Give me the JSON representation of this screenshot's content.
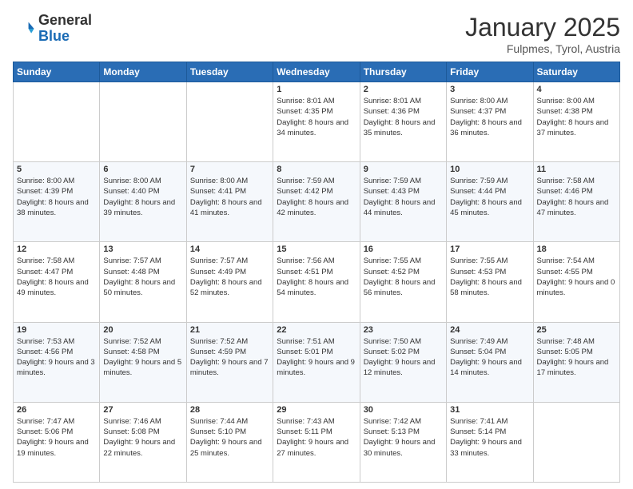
{
  "logo": {
    "general": "General",
    "blue": "Blue"
  },
  "header": {
    "month": "January 2025",
    "location": "Fulpmes, Tyrol, Austria"
  },
  "weekdays": [
    "Sunday",
    "Monday",
    "Tuesday",
    "Wednesday",
    "Thursday",
    "Friday",
    "Saturday"
  ],
  "weeks": [
    [
      {
        "day": null
      },
      {
        "day": null
      },
      {
        "day": null
      },
      {
        "day": 1,
        "sunrise": "8:01 AM",
        "sunset": "4:35 PM",
        "daylight": "8 hours and 34 minutes."
      },
      {
        "day": 2,
        "sunrise": "8:01 AM",
        "sunset": "4:36 PM",
        "daylight": "8 hours and 35 minutes."
      },
      {
        "day": 3,
        "sunrise": "8:00 AM",
        "sunset": "4:37 PM",
        "daylight": "8 hours and 36 minutes."
      },
      {
        "day": 4,
        "sunrise": "8:00 AM",
        "sunset": "4:38 PM",
        "daylight": "8 hours and 37 minutes."
      }
    ],
    [
      {
        "day": 5,
        "sunrise": "8:00 AM",
        "sunset": "4:39 PM",
        "daylight": "8 hours and 38 minutes."
      },
      {
        "day": 6,
        "sunrise": "8:00 AM",
        "sunset": "4:40 PM",
        "daylight": "8 hours and 39 minutes."
      },
      {
        "day": 7,
        "sunrise": "8:00 AM",
        "sunset": "4:41 PM",
        "daylight": "8 hours and 41 minutes."
      },
      {
        "day": 8,
        "sunrise": "7:59 AM",
        "sunset": "4:42 PM",
        "daylight": "8 hours and 42 minutes."
      },
      {
        "day": 9,
        "sunrise": "7:59 AM",
        "sunset": "4:43 PM",
        "daylight": "8 hours and 44 minutes."
      },
      {
        "day": 10,
        "sunrise": "7:59 AM",
        "sunset": "4:44 PM",
        "daylight": "8 hours and 45 minutes."
      },
      {
        "day": 11,
        "sunrise": "7:58 AM",
        "sunset": "4:46 PM",
        "daylight": "8 hours and 47 minutes."
      }
    ],
    [
      {
        "day": 12,
        "sunrise": "7:58 AM",
        "sunset": "4:47 PM",
        "daylight": "8 hours and 49 minutes."
      },
      {
        "day": 13,
        "sunrise": "7:57 AM",
        "sunset": "4:48 PM",
        "daylight": "8 hours and 50 minutes."
      },
      {
        "day": 14,
        "sunrise": "7:57 AM",
        "sunset": "4:49 PM",
        "daylight": "8 hours and 52 minutes."
      },
      {
        "day": 15,
        "sunrise": "7:56 AM",
        "sunset": "4:51 PM",
        "daylight": "8 hours and 54 minutes."
      },
      {
        "day": 16,
        "sunrise": "7:55 AM",
        "sunset": "4:52 PM",
        "daylight": "8 hours and 56 minutes."
      },
      {
        "day": 17,
        "sunrise": "7:55 AM",
        "sunset": "4:53 PM",
        "daylight": "8 hours and 58 minutes."
      },
      {
        "day": 18,
        "sunrise": "7:54 AM",
        "sunset": "4:55 PM",
        "daylight": "9 hours and 0 minutes."
      }
    ],
    [
      {
        "day": 19,
        "sunrise": "7:53 AM",
        "sunset": "4:56 PM",
        "daylight": "9 hours and 3 minutes."
      },
      {
        "day": 20,
        "sunrise": "7:52 AM",
        "sunset": "4:58 PM",
        "daylight": "9 hours and 5 minutes."
      },
      {
        "day": 21,
        "sunrise": "7:52 AM",
        "sunset": "4:59 PM",
        "daylight": "9 hours and 7 minutes."
      },
      {
        "day": 22,
        "sunrise": "7:51 AM",
        "sunset": "5:01 PM",
        "daylight": "9 hours and 9 minutes."
      },
      {
        "day": 23,
        "sunrise": "7:50 AM",
        "sunset": "5:02 PM",
        "daylight": "9 hours and 12 minutes."
      },
      {
        "day": 24,
        "sunrise": "7:49 AM",
        "sunset": "5:04 PM",
        "daylight": "9 hours and 14 minutes."
      },
      {
        "day": 25,
        "sunrise": "7:48 AM",
        "sunset": "5:05 PM",
        "daylight": "9 hours and 17 minutes."
      }
    ],
    [
      {
        "day": 26,
        "sunrise": "7:47 AM",
        "sunset": "5:06 PM",
        "daylight": "9 hours and 19 minutes."
      },
      {
        "day": 27,
        "sunrise": "7:46 AM",
        "sunset": "5:08 PM",
        "daylight": "9 hours and 22 minutes."
      },
      {
        "day": 28,
        "sunrise": "7:44 AM",
        "sunset": "5:10 PM",
        "daylight": "9 hours and 25 minutes."
      },
      {
        "day": 29,
        "sunrise": "7:43 AM",
        "sunset": "5:11 PM",
        "daylight": "9 hours and 27 minutes."
      },
      {
        "day": 30,
        "sunrise": "7:42 AM",
        "sunset": "5:13 PM",
        "daylight": "9 hours and 30 minutes."
      },
      {
        "day": 31,
        "sunrise": "7:41 AM",
        "sunset": "5:14 PM",
        "daylight": "9 hours and 33 minutes."
      },
      {
        "day": null
      }
    ]
  ],
  "labels": {
    "sunrise": "Sunrise:",
    "sunset": "Sunset:",
    "daylight": "Daylight:"
  }
}
